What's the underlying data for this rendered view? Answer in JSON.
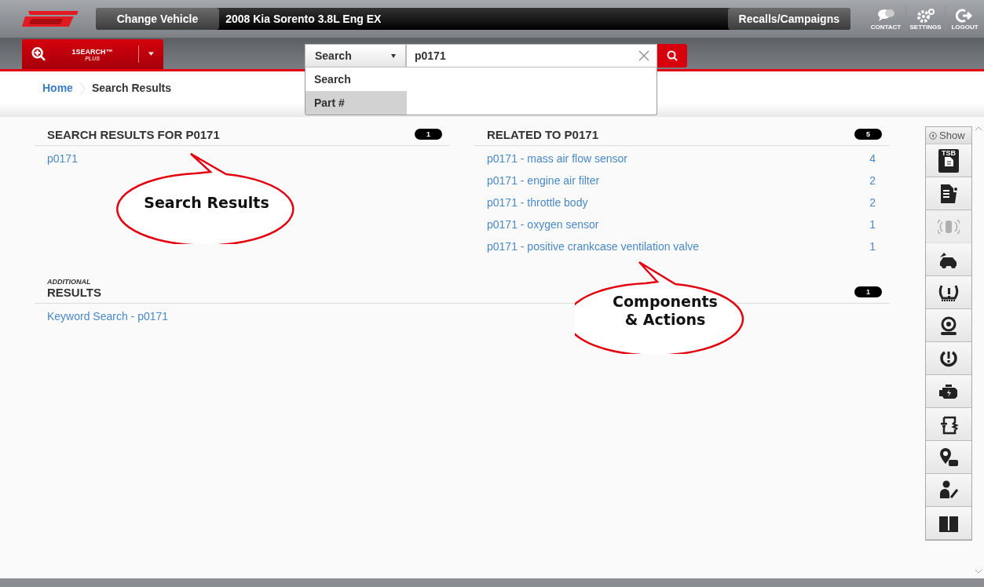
{
  "header": {
    "change_vehicle": "Change Vehicle",
    "vehicle": "2008 Kia Sorento 3.8L Eng EX",
    "recalls": "Recalls/Campaigns",
    "actions": [
      {
        "label": "CONTACT"
      },
      {
        "label": "SETTINGS"
      },
      {
        "label": "LOGOUT"
      }
    ]
  },
  "toolbar": {
    "module": {
      "label": "1SEARCH™",
      "sublabel": "PLUS"
    },
    "search_type": "Search",
    "query": "p0171",
    "menu": [
      {
        "label": "Search",
        "selected": false
      },
      {
        "label": "Part #",
        "selected": true
      }
    ]
  },
  "breadcrumb": [
    "Home",
    "Search Results"
  ],
  "search_results": {
    "title": "SEARCH RESULTS FOR P0171",
    "count": "1",
    "items": [
      "p0171"
    ]
  },
  "related": {
    "title": "RELATED TO P0171",
    "count": "5",
    "items": [
      {
        "label": "p0171 - mass air flow sensor",
        "count": "4"
      },
      {
        "label": "p0171 - engine air filter",
        "count": "2"
      },
      {
        "label": "p0171 - throttle body",
        "count": "2"
      },
      {
        "label": "p0171 - oxygen sensor",
        "count": "1"
      },
      {
        "label": "p0171 - positive crankcase ventilation valve",
        "count": "1"
      }
    ]
  },
  "additional": {
    "kicker": "ADDITIONAL",
    "title": "RESULTS",
    "count": "1",
    "items": [
      "Keyword Search - p0171"
    ]
  },
  "callouts": [
    {
      "text": "Search Results"
    },
    {
      "text": "Components & Actions"
    }
  ],
  "sidebar": {
    "show": "Show",
    "items": [
      {
        "label": "TSB",
        "disabled": false
      },
      {
        "disabled": false
      },
      {
        "disabled": true
      },
      {
        "disabled": false
      },
      {
        "disabled": false
      },
      {
        "disabled": false
      },
      {
        "disabled": false
      },
      {
        "disabled": false
      },
      {
        "disabled": false
      },
      {
        "disabled": false
      },
      {
        "disabled": false
      },
      {
        "disabled": false
      }
    ]
  }
}
